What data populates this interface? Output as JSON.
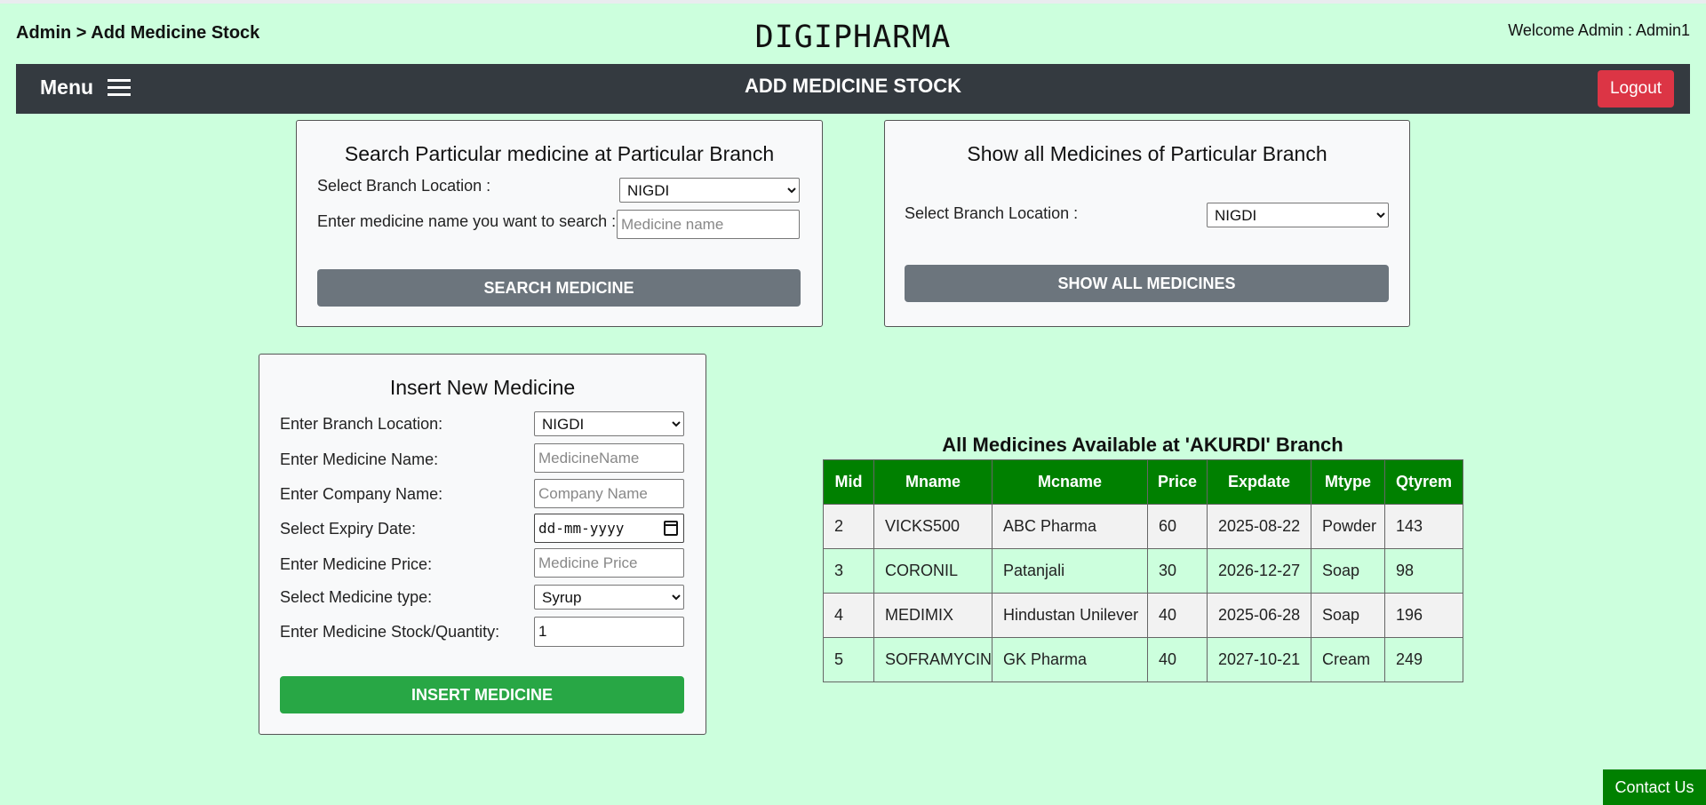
{
  "header": {
    "breadcrumb": "Admin > Add Medicine Stock",
    "brand": "DIGIPHARMA",
    "welcome": "Welcome Admin : Admin1"
  },
  "navbar": {
    "menu_label": "Menu",
    "title": "ADD MEDICINE STOCK",
    "logout_label": "Logout"
  },
  "search_panel": {
    "title": "Search Particular medicine at Particular Branch",
    "branch_label": "Select Branch Location :",
    "branch_value": "NIGDI",
    "medicine_label": "Enter medicine name you want to search :",
    "medicine_placeholder": "Medicine name",
    "button_label": "SEARCH MEDICINE"
  },
  "show_all_panel": {
    "title": "Show all Medicines of Particular Branch",
    "branch_label": "Select Branch Location :",
    "branch_value": "NIGDI",
    "button_label": "SHOW ALL MEDICINES"
  },
  "insert_panel": {
    "title": "Insert New Medicine",
    "branch_label": "Enter Branch Location:",
    "branch_value": "NIGDI",
    "name_label": "Enter Medicine Name:",
    "name_placeholder": "MedicineName",
    "company_label": "Enter Company Name:",
    "company_placeholder": "Company Name",
    "expiry_label": "Select Expiry Date:",
    "expiry_placeholder": "dd-mm-yyyy",
    "price_label": "Enter Medicine Price:",
    "price_placeholder": "Medicine Price",
    "type_label": "Select Medicine type:",
    "type_value": "Syrup",
    "stock_label": "Enter Medicine Stock/Quantity:",
    "stock_value": "1",
    "button_label": "INSERT MEDICINE"
  },
  "medicines_table": {
    "title": "All Medicines Available at 'AKURDI' Branch",
    "columns": [
      "Mid",
      "Mname",
      "Mcname",
      "Price",
      "Expdate",
      "Mtype",
      "Qtyrem"
    ],
    "rows": [
      [
        "2",
        "VICKS500",
        "ABC Pharma",
        "60",
        "2025-08-22",
        "Powder",
        "143"
      ],
      [
        "3",
        "CORONIL",
        "Patanjali",
        "30",
        "2026-12-27",
        "Soap",
        "98"
      ],
      [
        "4",
        "MEDIMIX",
        "Hindustan Unilever",
        "40",
        "2025-06-28",
        "Soap",
        "196"
      ],
      [
        "5",
        "SOFRAMYCIN",
        "GK Pharma",
        "40",
        "2027-10-21",
        "Cream",
        "249"
      ]
    ]
  },
  "footer": {
    "contact_label": "Contact Us"
  },
  "icons": {
    "menu": "hamburger-icon",
    "calendar": "calendar-icon",
    "dropdown": "chevron-down-icon"
  },
  "colors": {
    "background": "#ccffdd",
    "navbar": "#343a40",
    "logout": "#dc3545",
    "gray_button": "#6c757d",
    "insert_button": "#28a745",
    "table_header": "#008000"
  }
}
